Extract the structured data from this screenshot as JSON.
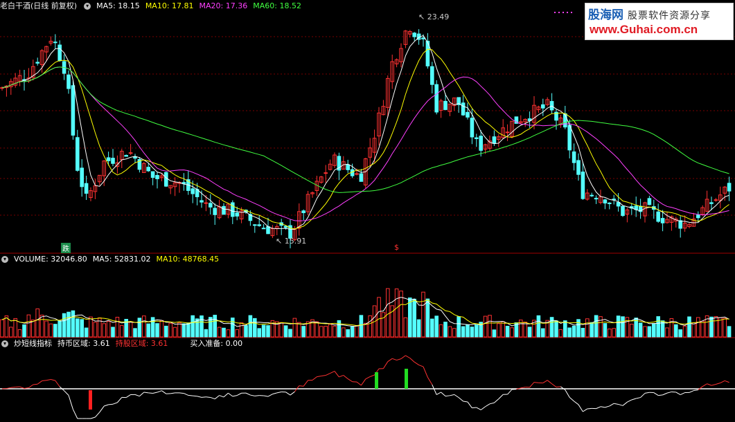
{
  "main_panel": {
    "title": "老白干酒(日线 前复权)",
    "ma5": "MA5: 18.15",
    "ma10": "MA10: 17.81",
    "ma20": "MA20: 17.36",
    "ma60": "MA60: 18.52",
    "high_label": "23.49",
    "low_label": "15.91",
    "event_mark_1": "跌",
    "event_mark_2": "$",
    "colors": {
      "up": "#ff3232",
      "down": "#54ffff",
      "ma5": "#ffffff",
      "ma10": "#ffff00",
      "ma20": "#ff40ff",
      "ma60": "#40ff40"
    }
  },
  "volume_panel": {
    "title": "VOLUME: 32046.80",
    "ma5": "MA5: 52831.02",
    "ma10": "MA10: 48768.45"
  },
  "indicator_panel": {
    "title": "炒短线指标",
    "hold_cash": "持币区域: 3.61",
    "hold_stock": "持股区域: 3.61",
    "buy_ready": "买入准备: 0.00"
  },
  "watermark": {
    "name": "股海网",
    "slogan": "股票软件资源分享",
    "url": "www.Guhai.com.cn"
  },
  "chart_data": {
    "type": "candlestick",
    "price_high": 23.49,
    "price_low": 15.91,
    "key_points": [
      {
        "label": "peak",
        "value": 23.49
      },
      {
        "label": "trough",
        "value": 15.91
      }
    ]
  }
}
